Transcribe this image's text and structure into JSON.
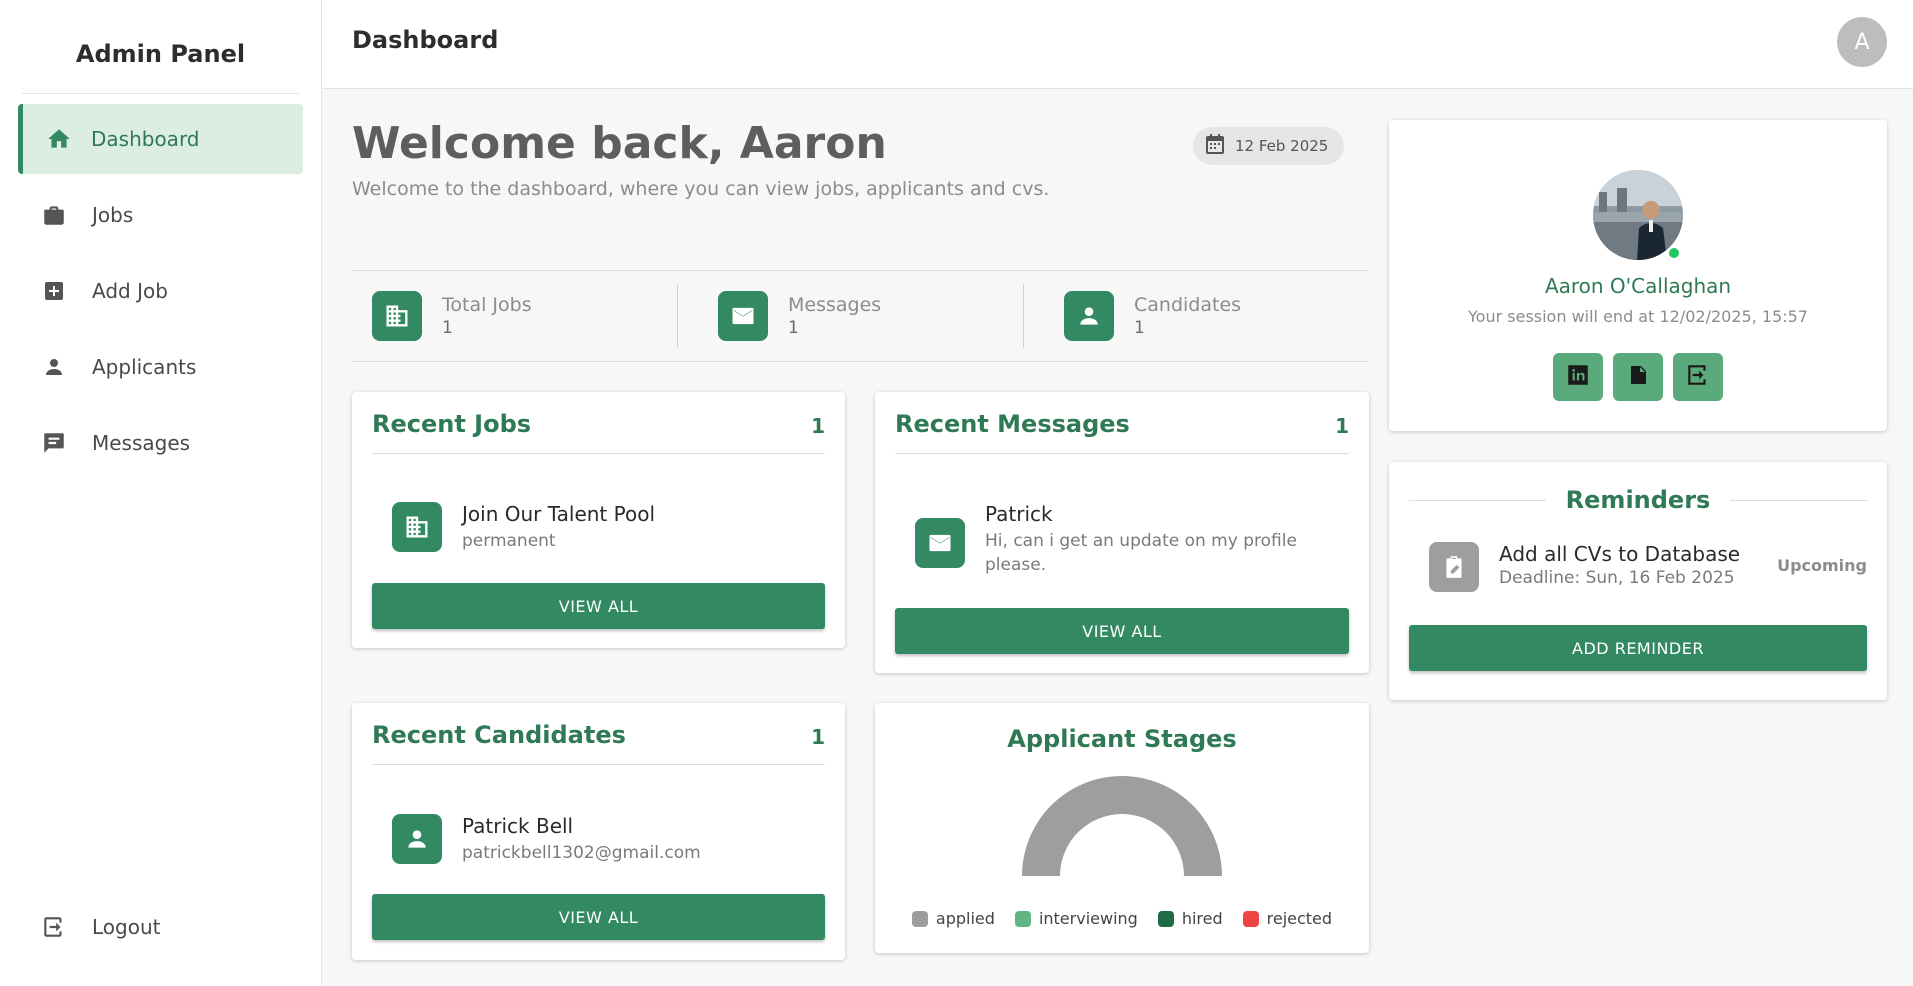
{
  "sidebar": {
    "title": "Admin Panel",
    "items": [
      {
        "label": "Dashboard",
        "icon": "home-icon"
      },
      {
        "label": "Jobs",
        "icon": "briefcase-icon"
      },
      {
        "label": "Add Job",
        "icon": "add-box-icon"
      },
      {
        "label": "Applicants",
        "icon": "person-icon"
      },
      {
        "label": "Messages",
        "icon": "chat-icon"
      }
    ],
    "logout_label": "Logout"
  },
  "header": {
    "title": "Dashboard",
    "avatar_letter": "A"
  },
  "welcome": {
    "title": "Welcome back, Aaron",
    "subtitle": "Welcome to the dashboard, where you can view jobs, applicants and cvs.",
    "date": "12 Feb 2025"
  },
  "stats": [
    {
      "label": "Total Jobs",
      "value": "1"
    },
    {
      "label": "Messages",
      "value": "1"
    },
    {
      "label": "Candidates",
      "value": "1"
    }
  ],
  "recent_jobs": {
    "title": "Recent Jobs",
    "count": "1",
    "item_title": "Join Our Talent Pool",
    "item_sub": "permanent",
    "button": "VIEW ALL"
  },
  "recent_messages": {
    "title": "Recent Messages",
    "count": "1",
    "item_title": "Patrick",
    "item_sub": "Hi, can i get an update on my profile please.",
    "button": "VIEW ALL"
  },
  "recent_candidates": {
    "title": "Recent Candidates",
    "count": "1",
    "item_title": "Patrick Bell",
    "item_sub": "patrickbell1302@gmail.com",
    "button": "VIEW ALL"
  },
  "applicant_stages": {
    "title": "Applicant Stages",
    "legend": [
      {
        "label": "applied",
        "color": "#9e9e9e"
      },
      {
        "label": "interviewing",
        "color": "#5fb584"
      },
      {
        "label": "hired",
        "color": "#1f6b48"
      },
      {
        "label": "rejected",
        "color": "#ef4444"
      }
    ]
  },
  "chart_data": {
    "type": "pie",
    "title": "Applicant Stages",
    "categories": [
      "applied",
      "interviewing",
      "hired",
      "rejected"
    ],
    "values": [
      1,
      0,
      0,
      0
    ],
    "legend": "bottom"
  },
  "profile": {
    "name": "Aaron O'Callaghan",
    "session": "Your session will end at 12/02/2025, 15:57",
    "buttons": [
      "linkedin-icon",
      "document-icon",
      "logout-icon"
    ]
  },
  "reminders": {
    "title": "Reminders",
    "item_title": "Add all CVs to Database",
    "item_sub": "Deadline: Sun, 16 Feb 2025",
    "status": "Upcoming",
    "button": "ADD REMINDER"
  },
  "colors": {
    "primary": "#338a62",
    "primary_dark": "#2f7a55",
    "active_bg": "#dcede4",
    "online": "#22c55e"
  }
}
